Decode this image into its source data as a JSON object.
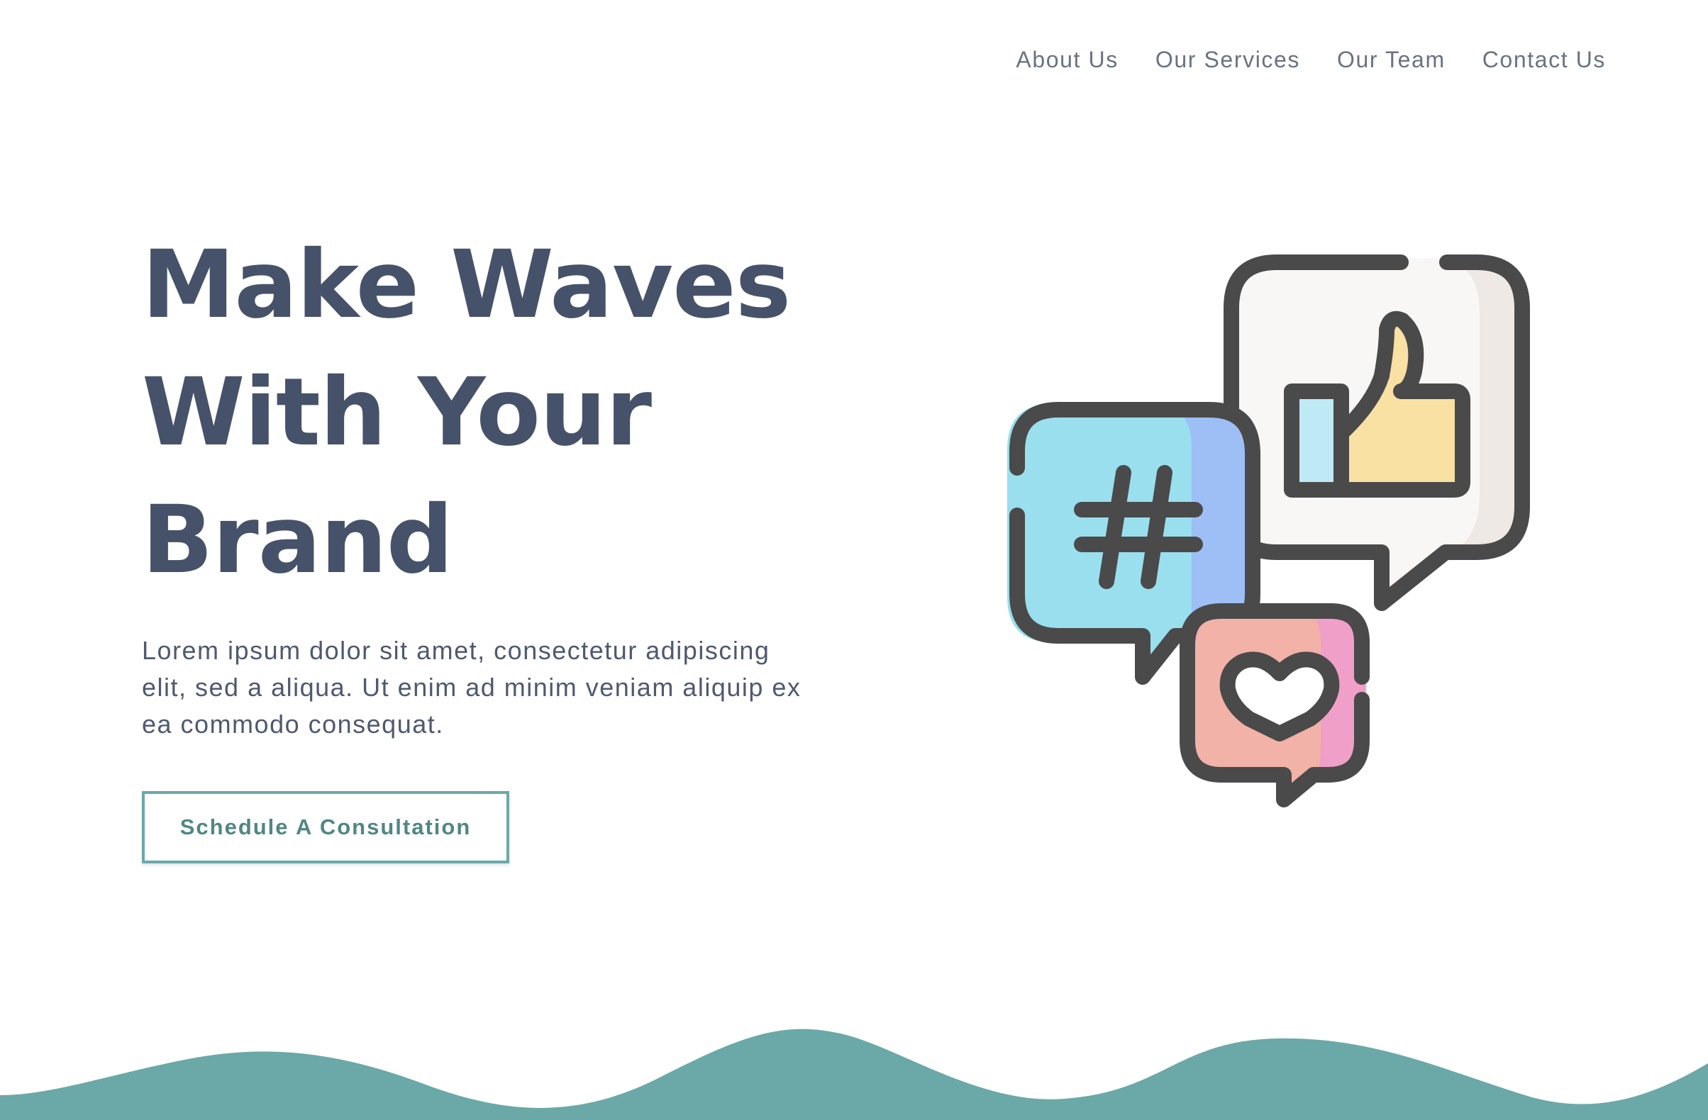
{
  "nav": {
    "items": [
      {
        "label": "About Us"
      },
      {
        "label": "Our Services"
      },
      {
        "label": "Our Team"
      },
      {
        "label": "Contact Us"
      }
    ]
  },
  "hero": {
    "title_lines": [
      "Make Waves",
      "With Your",
      "Brand"
    ],
    "description": "Lorem ipsum dolor sit amet, consectetur adipiscing elit, sed a aliqua. Ut enim ad minim veniam aliquip ex ea commodo consequat.",
    "cta_label": "Schedule A Consultation"
  },
  "illustration": {
    "icons": [
      "hashtag-icon",
      "thumbs-up-icon",
      "heart-icon"
    ]
  },
  "colors": {
    "heading": "#46526a",
    "body_text": "#4f5970",
    "nav_text": "#6a7282",
    "accent": "#6aa9a8",
    "wave": "#6aa9a8",
    "icon_outline": "#4a4a4a",
    "hashtag_bubble": "#99dfee",
    "hashtag_bubble_shade": "#9dbff6",
    "like_bubble": "#f9f7f6",
    "like_bubble_shade": "#efe9e5",
    "thumb": "#f9e0a3",
    "cuff": "#bfeaf5",
    "heart_bubble": "#f2b2a7",
    "heart_bubble_shade": "#f0a0c8"
  }
}
